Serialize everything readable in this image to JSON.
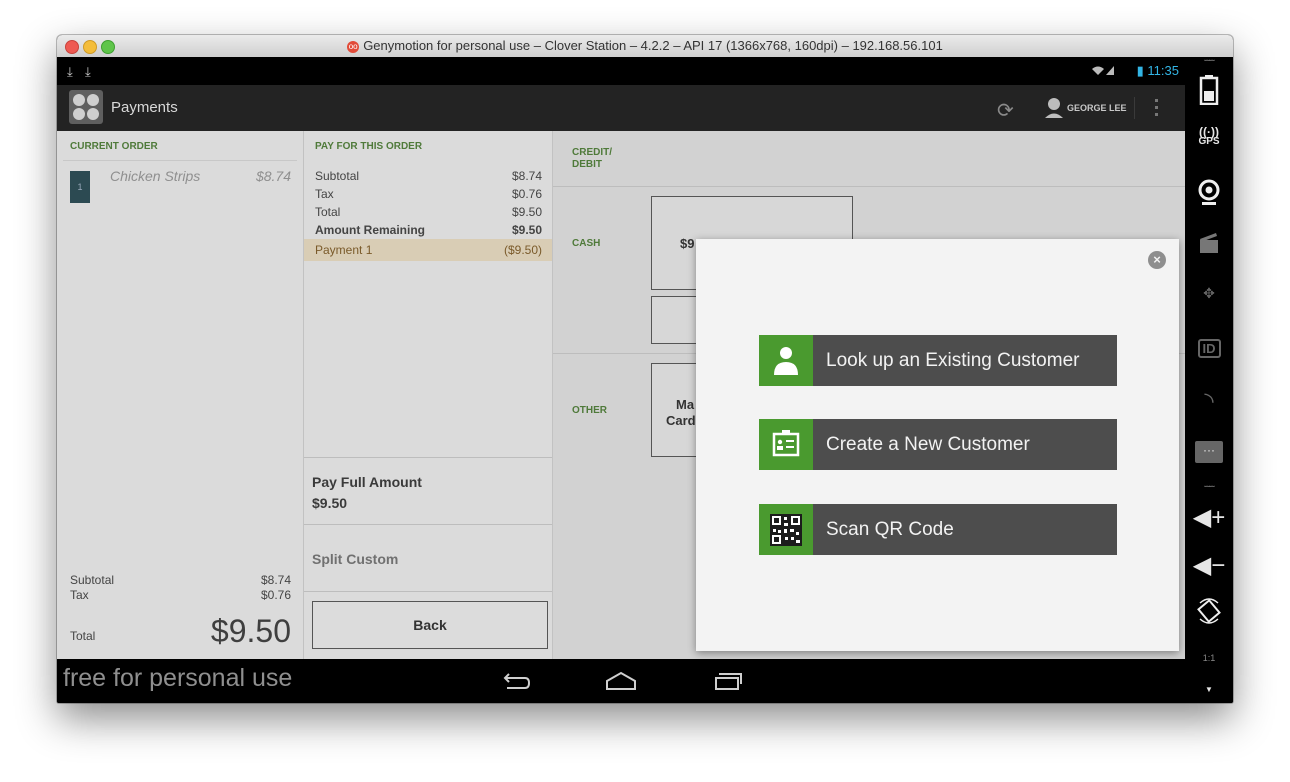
{
  "window": {
    "title": "Genymotion for personal use – Clover Station – 4.2.2 – API 17 (1366x768, 160dpi) – 192.168.56.101"
  },
  "statusbar": {
    "time": "11:35"
  },
  "actionbar": {
    "title": "Payments",
    "user": "GEORGE LEE"
  },
  "current_order": {
    "header": "CURRENT ORDER",
    "items": [
      {
        "qty": "1",
        "name": "Chicken Strips",
        "price": "$8.74"
      }
    ],
    "subtotal_label": "Subtotal",
    "subtotal": "$8.74",
    "tax_label": "Tax",
    "tax": "$0.76",
    "total_label": "Total",
    "total": "$9.50"
  },
  "pay_order": {
    "header": "PAY FOR THIS ORDER",
    "rows": [
      {
        "label": "Subtotal",
        "value": "$8.74"
      },
      {
        "label": "Tax",
        "value": "$0.76"
      },
      {
        "label": "Total",
        "value": "$9.50"
      },
      {
        "label": "Amount Remaining",
        "value": "$9.50"
      },
      {
        "label": "Payment 1",
        "value": "($9.50)"
      }
    ],
    "pay_full_label": "Pay Full Amount",
    "pay_full_amount": "$9.50",
    "split_label": "Split Custom",
    "back_label": "Back"
  },
  "tender": {
    "credit_label_1": "CREDIT/",
    "credit_label_2": "DEBIT",
    "cash_label": "CASH",
    "cash_button_partial": "$9",
    "other_label": "OTHER",
    "other_button_line1": "Ma",
    "other_button_line2": "Card"
  },
  "modal": {
    "buttons": [
      {
        "label": "Look up an Existing Customer",
        "icon": "person-icon"
      },
      {
        "label": "Create a New Customer",
        "icon": "id-card-icon"
      },
      {
        "label": "Scan QR Code",
        "icon": "qr-code-icon"
      }
    ]
  },
  "navbar": {
    "watermark": "free for personal use"
  },
  "sidebar": {
    "gps_label": "GPS",
    "id_label": "ID",
    "ratio_label": "1:1"
  },
  "colors": {
    "accent_green": "#4a9a2f",
    "header_green": "#4f7a3a",
    "status_blue": "#33b5e5"
  }
}
